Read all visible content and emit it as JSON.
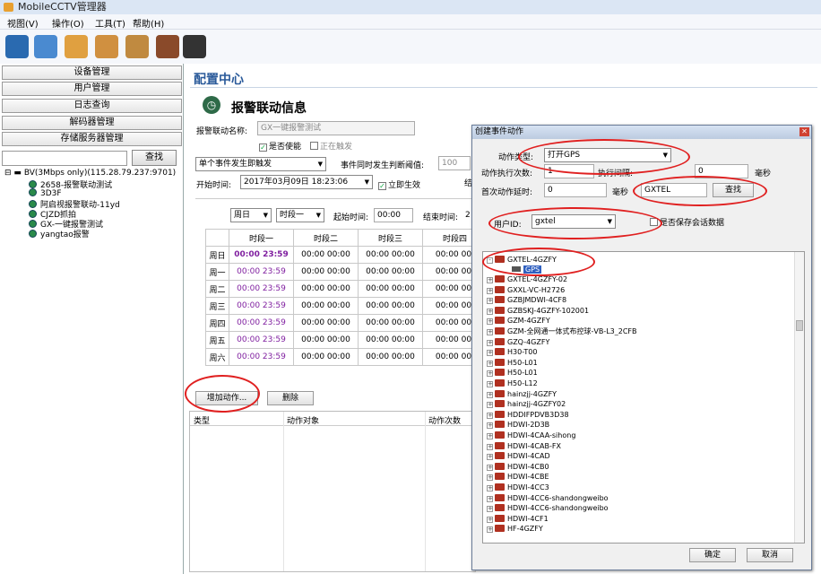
{
  "app": {
    "title": "MobileCCTV管理器"
  },
  "menu": [
    "视图(V)",
    "操作(O)",
    "工具(T)",
    "帮助(H)"
  ],
  "left": {
    "nav": [
      "设备管理",
      "用户管理",
      "日志查询",
      "解码器管理",
      "存储服务器管理"
    ],
    "search_button": "查找",
    "tree_root": "BV(3Mbps only)(115.28.79.237:9701)",
    "tree_items": [
      "2658-报警联动测试",
      "3D3F",
      "阿启视报警联动-11yd",
      "CJZD抓拍",
      "GX-一键报警测试",
      "yangtao报警"
    ]
  },
  "main": {
    "page_title": "配置中心",
    "section_title": "报警联动信息",
    "name_label": "报警联动名称:",
    "name_value": "GX一键报警测试",
    "enabled_label": "是否使能",
    "triggering_label": "正在触发",
    "trigger_mode": "单个事件发生即触发",
    "threshold_label": "事件同时发生判断阈值:",
    "threshold_value": "100",
    "start_label": "开始时间:",
    "start_value": "2017年03月09日 18:23:06",
    "immediate_label": "立即生效",
    "end_label_partial": "结",
    "week_select": "周日",
    "period_select": "时段一",
    "begin_label": "起始时间:",
    "begin_value": "00:00",
    "stop_label": "结束时间:",
    "stop_value_partial": "2",
    "schedule": {
      "headers": [
        "时段一",
        "时段二",
        "时段三",
        "时段四"
      ],
      "rows": [
        {
          "day": "周日",
          "cells": [
            "00:00 23:59",
            "00:00 00:00",
            "00:00 00:00",
            "00:00 00:"
          ]
        },
        {
          "day": "周一",
          "cells": [
            "00:00 23:59",
            "00:00 00:00",
            "00:00 00:00",
            "00:00 00:"
          ]
        },
        {
          "day": "周二",
          "cells": [
            "00:00 23:59",
            "00:00 00:00",
            "00:00 00:00",
            "00:00 00:"
          ]
        },
        {
          "day": "周三",
          "cells": [
            "00:00 23:59",
            "00:00 00:00",
            "00:00 00:00",
            "00:00 00:"
          ]
        },
        {
          "day": "周四",
          "cells": [
            "00:00 23:59",
            "00:00 00:00",
            "00:00 00:00",
            "00:00 00:"
          ]
        },
        {
          "day": "周五",
          "cells": [
            "00:00 23:59",
            "00:00 00:00",
            "00:00 00:00",
            "00:00 00:"
          ]
        },
        {
          "day": "周六",
          "cells": [
            "00:00 23:59",
            "00:00 00:00",
            "00:00 00:00",
            "00:00 00:"
          ]
        }
      ]
    },
    "add_action": "增加动作...",
    "delete": "删除",
    "grid_headers": [
      "类型",
      "动作对象",
      "动作次数"
    ]
  },
  "dialog": {
    "title": "创建事件动作",
    "action_type_label": "动作类型:",
    "action_type_value": "打开GPS",
    "exec_count_label": "动作执行次数:",
    "exec_count_value": "1",
    "interval_label": "执行间隔:",
    "interval_value": "0",
    "ms1": "毫秒",
    "first_delay_label": "首次动作延时:",
    "first_delay_value": "0",
    "ms2": "毫秒",
    "search_value": "GXTEL",
    "search_button": "查找",
    "user_id_label": "用户ID:",
    "user_id_value": "gxtel",
    "save_session_label": "是否保存会话数据",
    "tree_expanded": "GXTEL-4GZFY",
    "tree_child": "GPS",
    "tree_items": [
      "GXTEL-4GZFY-02",
      "GXXL-VC-H2726",
      "GZBJMDWI-4CF8",
      "GZBSKJ-4GZFY-102001",
      "GZM-4GZFY",
      "GZM-全网通一体式布控球-VB-L3_2CFB",
      "GZQ-4GZFY",
      "H30-T00",
      "H50-L01",
      "H50-L01",
      "H50-L12",
      "hainzjj-4GZFY",
      "hainzjj-4GZFY02",
      "HDDIFPDVB3D38",
      "HDWI-2D3B",
      "HDWI-4CAA-sihong",
      "HDWI-4CAB-FX",
      "HDWI-4CAD",
      "HDWI-4CB0",
      "HDWI-4CBE",
      "HDWI-4CC3",
      "HDWI-4CC6-shandongweibo",
      "HDWI-4CC6-shandongweibo",
      "HDWI-4CF1",
      "HF-4GZFY"
    ],
    "ok": "确定",
    "cancel": "取消"
  },
  "colors": {
    "title_blue": "#2a5a9a",
    "annotation_red": "#e02020",
    "purple_time": "#8020a0"
  }
}
